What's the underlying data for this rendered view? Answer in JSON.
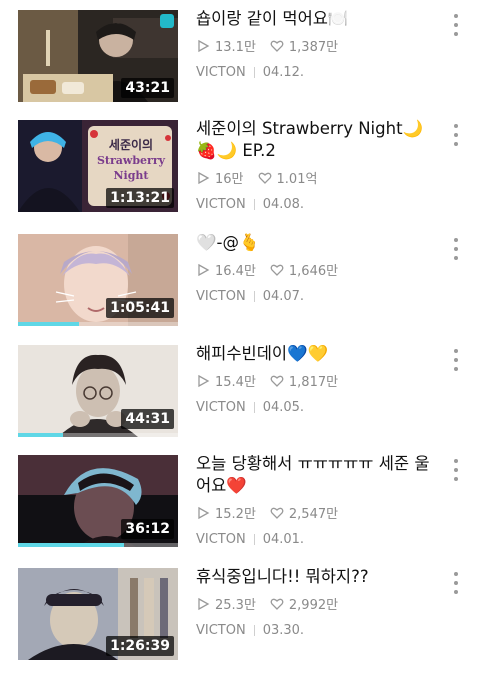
{
  "videos": [
    {
      "title": "숍이랑 같이 먹어요🍽️",
      "views": "13.1만",
      "likes": "1,387만",
      "channel": "VICTON",
      "date": "04.12.",
      "duration": "43:21",
      "progress": 0,
      "thumb_colors": [
        "#6b5a44",
        "#2b2622",
        "#d8c7a3"
      ]
    },
    {
      "title": "세준이의 Strawberry Night🌙🍓🌙 EP.2",
      "views": "16만",
      "likes": "1.01억",
      "channel": "VICTON",
      "date": "04.08.",
      "duration": "1:13:21",
      "progress": 0,
      "thumb_text_line1": "세준이의",
      "thumb_text_line2": "Strawberry",
      "thumb_text_line3": "Night",
      "thumb_colors": [
        "#1b1a2e",
        "#7a5a86",
        "#e6d7c3"
      ]
    },
    {
      "title": "🤍-@🫰",
      "views": "16.4만",
      "likes": "1,646만",
      "channel": "VICTON",
      "date": "04.07.",
      "duration": "1:05:41",
      "progress": 0.38,
      "thumb_colors": [
        "#d9b7a5",
        "#b8a9c9",
        "#f2d9cc"
      ]
    },
    {
      "title": "해피수빈데이💙💛",
      "views": "15.4만",
      "likes": "1,817만",
      "channel": "VICTON",
      "date": "04.05.",
      "duration": "44:31",
      "progress": 0.28,
      "thumb_colors": [
        "#e9e4de",
        "#2a2222",
        "#cdbfb2"
      ]
    },
    {
      "title": "오늘 당황해서 ㅠㅠㅠㅠㅠ 세준 울어요❤️",
      "views": "15.2만",
      "likes": "2,547만",
      "channel": "VICTON",
      "date": "04.01.",
      "duration": "36:12",
      "progress": 0.66,
      "thumb_colors": [
        "#4a2f38",
        "#111014",
        "#6b4d52"
      ]
    },
    {
      "title": "휴식중입니다!! 뭐하지??",
      "views": "25.3만",
      "likes": "2,992만",
      "channel": "VICTON",
      "date": "03.30.",
      "duration": "1:26:39",
      "progress": 0,
      "thumb_colors": [
        "#a3a8b5",
        "#24202c",
        "#d5c9b8"
      ]
    }
  ],
  "icons": {
    "play": "play-icon",
    "heart": "heart-icon",
    "more": "more-vertical-icon",
    "vlive": "vlive-badge-icon"
  },
  "colors": {
    "progress": "#5fd7e6",
    "meta_text": "#8a8a8a"
  }
}
